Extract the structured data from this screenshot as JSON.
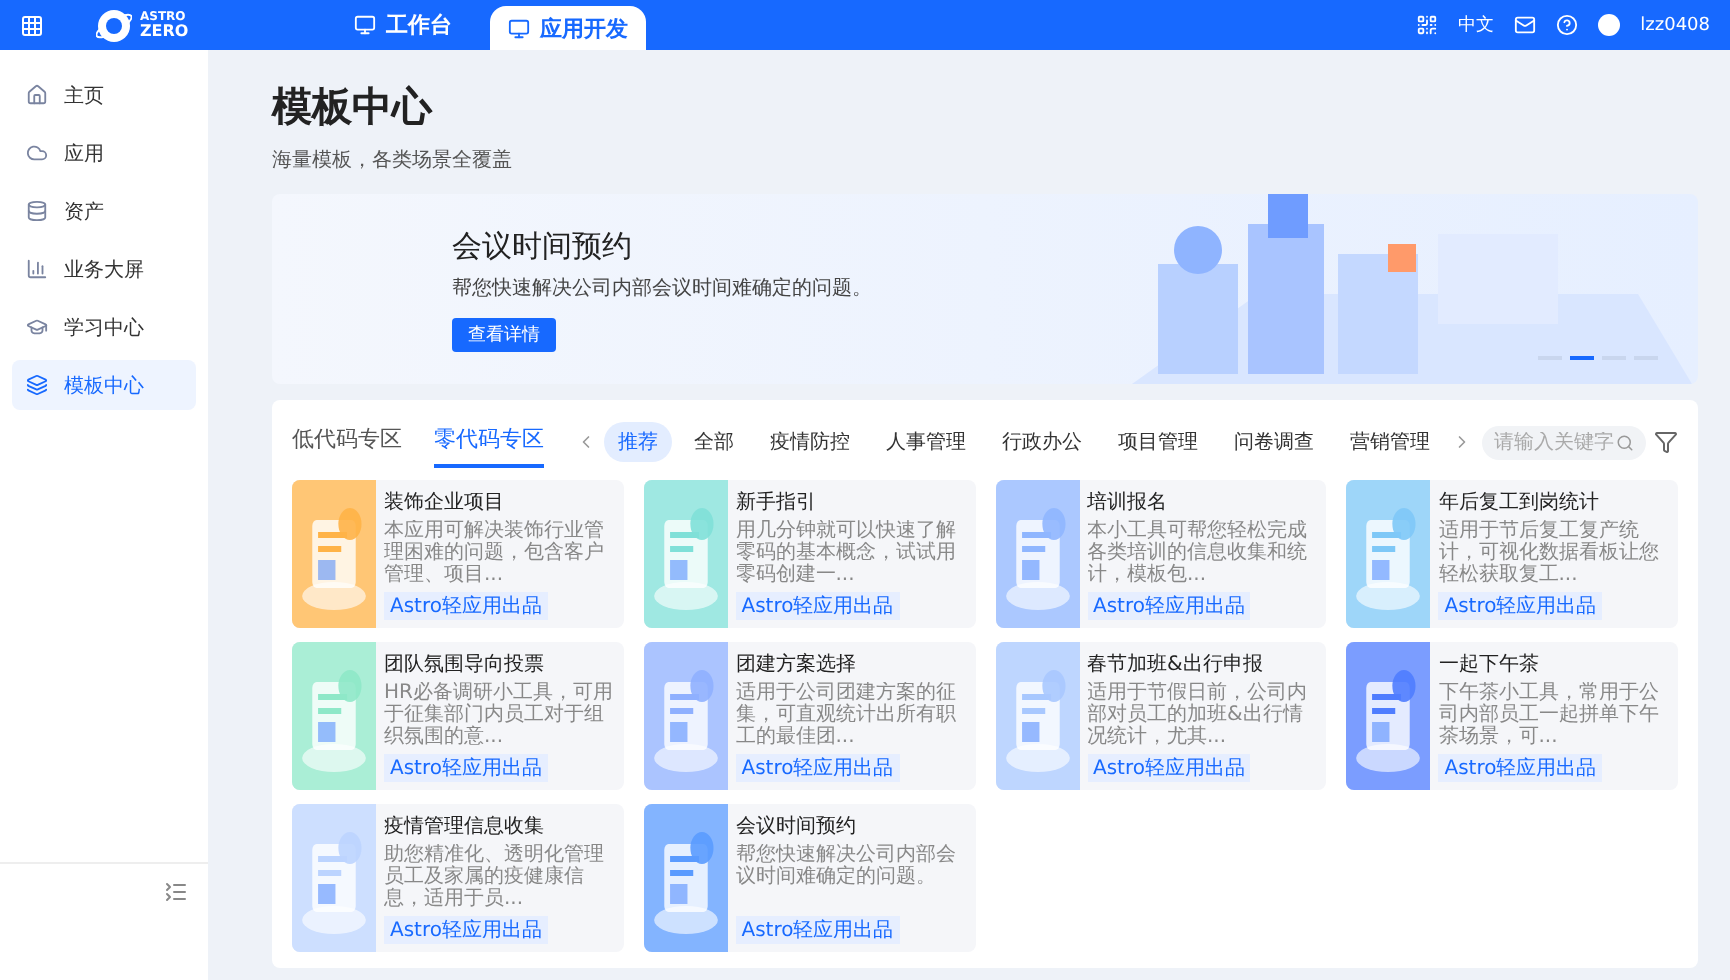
{
  "topbar": {
    "logo_top": "ASTRO",
    "logo_bottom": "ZERO",
    "tabs": [
      {
        "label": "工作台",
        "selected": false
      },
      {
        "label": "应用开发",
        "selected": true
      }
    ],
    "language": "中文",
    "user": "lzz0408"
  },
  "sidebar": {
    "items": [
      {
        "label": "主页",
        "selected": false
      },
      {
        "label": "应用",
        "selected": false
      },
      {
        "label": "资产",
        "selected": false
      },
      {
        "label": "业务大屏",
        "selected": false
      },
      {
        "label": "学习中心",
        "selected": false
      },
      {
        "label": "模板中心",
        "selected": true
      }
    ]
  },
  "page": {
    "title": "模板中心",
    "subtitle": "海量模板，各类场景全覆盖"
  },
  "banner": {
    "title": "会议时间预约",
    "text": "帮您快速解决公司内部会议时间难确定的问题。",
    "button": "查看详情",
    "slides": [
      {
        "selected": false
      },
      {
        "selected": true
      },
      {
        "selected": false
      },
      {
        "selected": false
      }
    ]
  },
  "zones": [
    {
      "label": "低代码专区",
      "selected": false
    },
    {
      "label": "零代码专区",
      "selected": true
    }
  ],
  "categories": [
    {
      "label": "推荐",
      "selected": true
    },
    {
      "label": "全部",
      "selected": false
    },
    {
      "label": "疫情防控",
      "selected": false
    },
    {
      "label": "人事管理",
      "selected": false
    },
    {
      "label": "行政办公",
      "selected": false
    },
    {
      "label": "项目管理",
      "selected": false
    },
    {
      "label": "问卷调查",
      "selected": false
    },
    {
      "label": "营销管理",
      "selected": false
    }
  ],
  "search": {
    "placeholder": "请输入关键字"
  },
  "templates": [
    {
      "title": "装饰企业项目",
      "description": "本应用可解决装饰行业管理困难的问题，包含客户管理、项目...",
      "tag": "Astro轻应用出品"
    },
    {
      "title": "新手指引",
      "description": "用几分钟就可以快速了解零码的基本概念，试试用零码创建一...",
      "tag": "Astro轻应用出品"
    },
    {
      "title": "培训报名",
      "description": "本小工具可帮您轻松完成各类培训的信息收集和统计，模板包...",
      "tag": "Astro轻应用出品"
    },
    {
      "title": "年后复工到岗统计",
      "description": "适用于节后复工复产统计，可视化数据看板让您轻松获取复工...",
      "tag": "Astro轻应用出品"
    },
    {
      "title": "团队氛围导向投票",
      "description": "HR必备调研小工具，可用于征集部门内员工对于组织氛围的意...",
      "tag": "Astro轻应用出品"
    },
    {
      "title": "团建方案选择",
      "description": "适用于公司团建方案的征集，可直观统计出所有职工的最佳团...",
      "tag": "Astro轻应用出品"
    },
    {
      "title": "春节加班&出行申报",
      "description": "适用于节假日前，公司内部对员工的加班&出行情况统计，尤其...",
      "tag": "Astro轻应用出品"
    },
    {
      "title": "一起下午茶",
      "description": "下午茶小工具，常用于公司内部员工一起拼单下午茶场景，可...",
      "tag": "Astro轻应用出品"
    },
    {
      "title": "疫情管理信息收集",
      "description": "助您精准化、透明化管理员工及家属的疫健康信息，适用于员...",
      "tag": "Astro轻应用出品"
    },
    {
      "title": "会议时间预约",
      "description": "帮您快速解决公司内部会议时间难确定的问题。",
      "tag": "Astro轻应用出品"
    }
  ]
}
